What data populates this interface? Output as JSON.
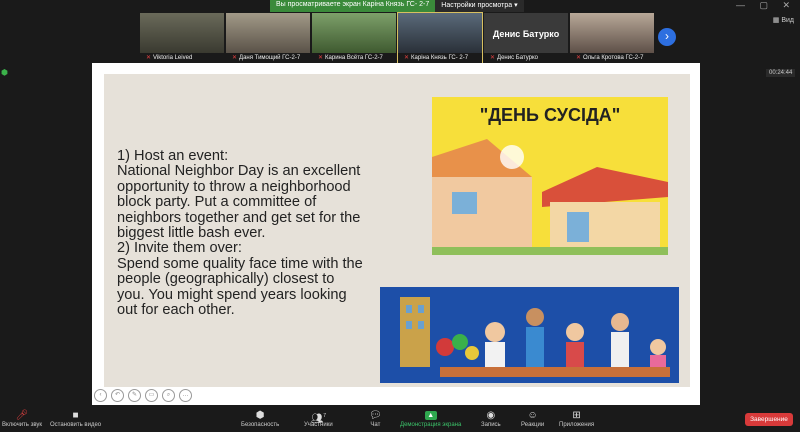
{
  "top": {
    "share_notice": "Вы просматриваете экран Каріна Князь ГС- 2-7",
    "view_options": "Настройки просмотра ▾",
    "window_controls": "— ▢ ✕",
    "view_toggle": "▦ Вид"
  },
  "participants": [
    {
      "name": "Viktoria Leived",
      "muted": true
    },
    {
      "name": "Даня Тимощий ГС-2-7",
      "muted": true
    },
    {
      "name": "Карина Всёта ГС-2-7",
      "muted": true
    },
    {
      "name": "Каріна Князь ГС- 2-7",
      "muted": true,
      "active": true
    },
    {
      "name": "Денис Батурко",
      "muted": true,
      "big_name": "Денис Батурко"
    },
    {
      "name": "Ольга Кротова ГС-2-7",
      "muted": true
    }
  ],
  "timer": "00:24:44",
  "slide": {
    "text_lines": [
      "1) Host an event:",
      "National Neighbor Day is an excellent",
      "opportunity to throw a neighborhood",
      "block party. Put a committee of",
      "neighbors together and get set for the",
      "biggest little bash ever.",
      "2) Invite them over:",
      "Spend some quality face time with the",
      "people (geographically) closest to",
      "you. You might spend years looking",
      "out for each other."
    ],
    "image1_title": "\"ДЕНЬ СУСІДА\""
  },
  "controls": {
    "mute": "Включить звук",
    "video": "Остановить видео",
    "security": "Безопасность",
    "participants": "Участники",
    "participants_count": "7",
    "chat": "Чат",
    "share": "Демонстрация экрана",
    "record": "Запись",
    "reactions": "Реакции",
    "apps": "Приложения",
    "end": "Завершение"
  },
  "colors": {
    "accent": "#2d6fe0",
    "end": "#d83a3a",
    "share": "#2fa84f"
  }
}
